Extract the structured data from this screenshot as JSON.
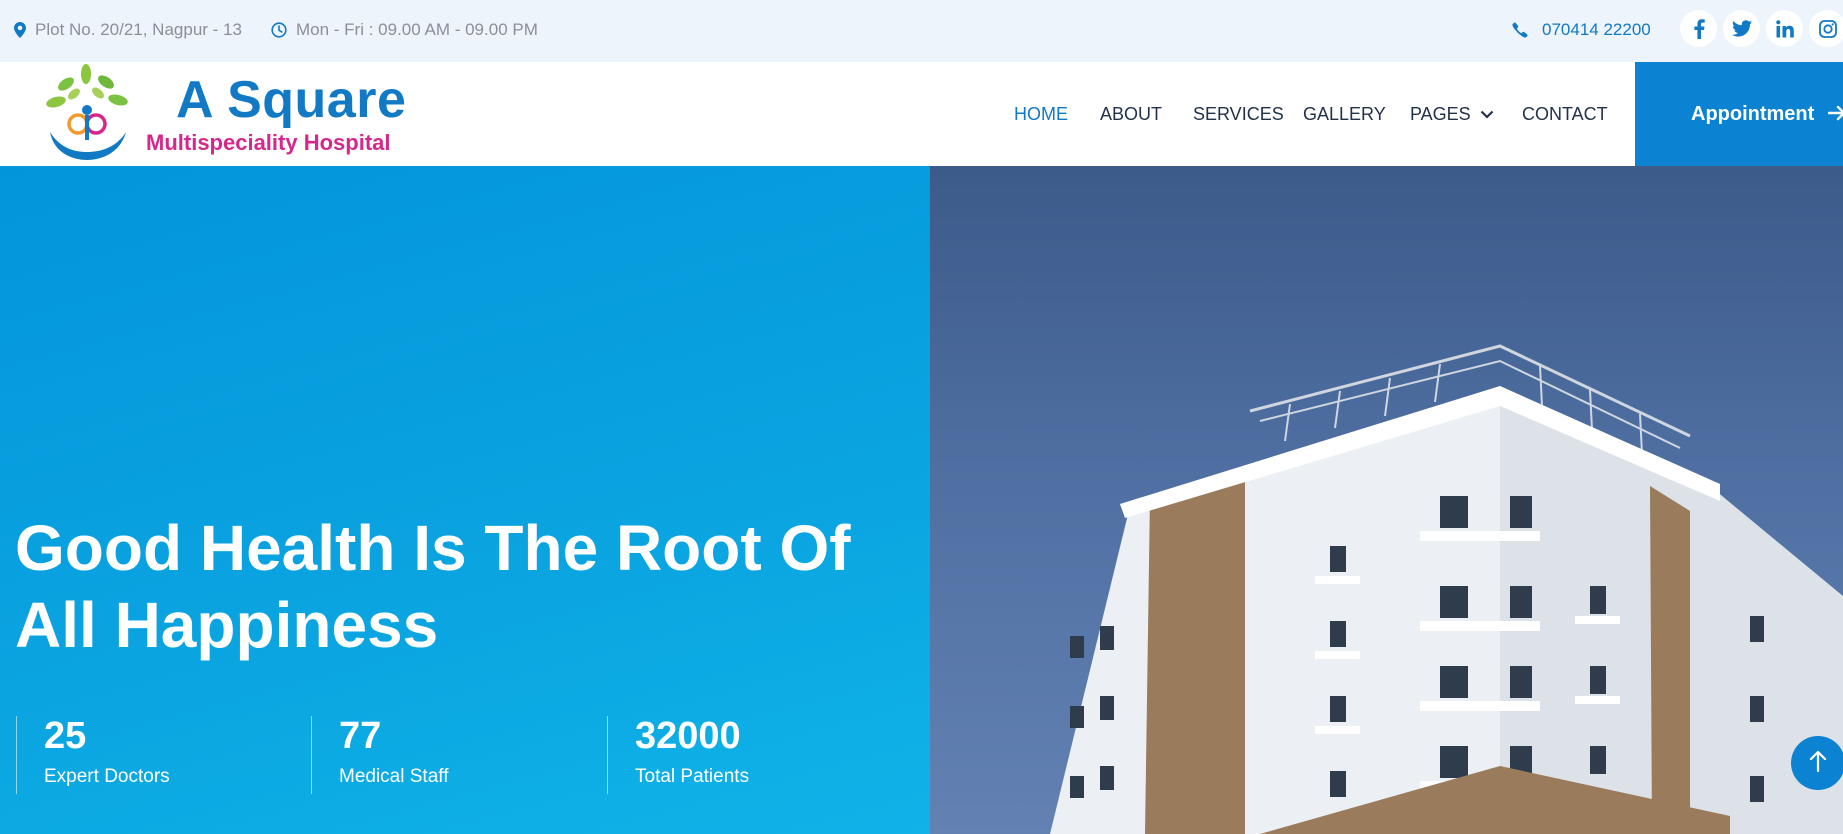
{
  "topbar": {
    "address": "Plot No. 20/21, Nagpur - 13",
    "hours": "Mon - Fri : 09.00 AM - 09.00 PM",
    "phone": "070414 22200",
    "socials": [
      {
        "icon": "facebook-icon",
        "glyph": "f"
      },
      {
        "icon": "twitter-icon",
        "glyph": "t"
      },
      {
        "icon": "linkedin-icon",
        "glyph": "in"
      },
      {
        "icon": "instagram-icon",
        "glyph": "ig"
      }
    ]
  },
  "brand": {
    "title": "A Square",
    "subtitle": "Multispeciality Hospital"
  },
  "nav": {
    "items": [
      "HOME",
      "ABOUT",
      "SERVICES",
      "GALLERY",
      "PAGES",
      "CONTACT"
    ],
    "active": "HOME",
    "cta": "Appointment"
  },
  "hero": {
    "headline_line1": "Good Health Is The Root Of",
    "headline_line2": "All Happiness",
    "stats": [
      {
        "value": "25",
        "label": "Expert Doctors"
      },
      {
        "value": "77",
        "label": "Medical Staff"
      },
      {
        "value": "32000",
        "label": "Total Patients"
      }
    ]
  },
  "colors": {
    "accent": "#1279c5",
    "cta": "#0b83d2",
    "brand_pink": "#d6288a",
    "hero_blue": "#0aa3e0"
  }
}
